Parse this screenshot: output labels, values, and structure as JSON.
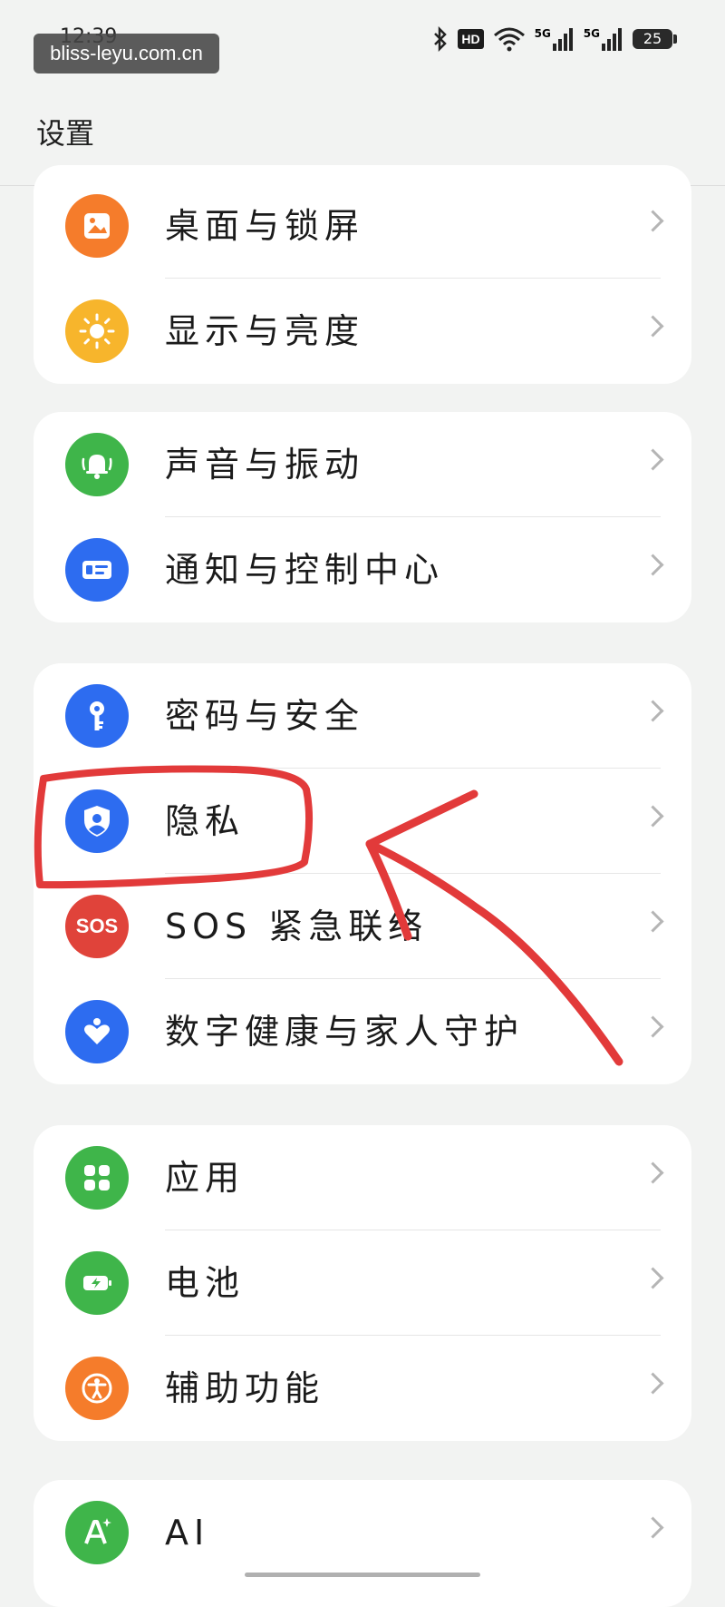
{
  "status_bar": {
    "time": "12:39",
    "watermark": "bliss-leyu.com.cn",
    "hd_badge": "HD",
    "network_1": "5G",
    "network_2": "5G",
    "battery": "25"
  },
  "header": {
    "title": "设置"
  },
  "groups": [
    {
      "items": [
        {
          "label": "桌面与锁屏",
          "icon": "wallpaper-icon",
          "color": "#f57c2b"
        },
        {
          "label": "显示与亮度",
          "icon": "sun-icon",
          "color": "#f7b52c"
        }
      ]
    },
    {
      "items": [
        {
          "label": "声音与振动",
          "icon": "bell-icon",
          "color": "#3fb54a"
        },
        {
          "label": "通知与控制中心",
          "icon": "notification-icon",
          "color": "#2d6cf0"
        }
      ]
    },
    {
      "items": [
        {
          "label": "密码与安全",
          "icon": "key-icon",
          "color": "#2d6cf0"
        },
        {
          "label": "隐私",
          "icon": "privacy-shield-icon",
          "color": "#2d6cf0"
        },
        {
          "label": "SOS 紧急联络",
          "icon": "sos-icon",
          "icon_text": "SOS",
          "color": "#e0433a"
        },
        {
          "label": "数字健康与家人守护",
          "icon": "heart-icon",
          "color": "#2d6cf0"
        }
      ]
    },
    {
      "items": [
        {
          "label": "应用",
          "icon": "apps-icon",
          "color": "#3fb54a"
        },
        {
          "label": "电池",
          "icon": "battery-icon",
          "color": "#3fb54a"
        },
        {
          "label": "辅助功能",
          "icon": "accessibility-icon",
          "color": "#f57c2b"
        }
      ]
    },
    {
      "items": [
        {
          "label": "AI",
          "icon": "ai-icon",
          "color": "#3fb54a"
        }
      ]
    }
  ],
  "annotation_color": "#e23a3a"
}
